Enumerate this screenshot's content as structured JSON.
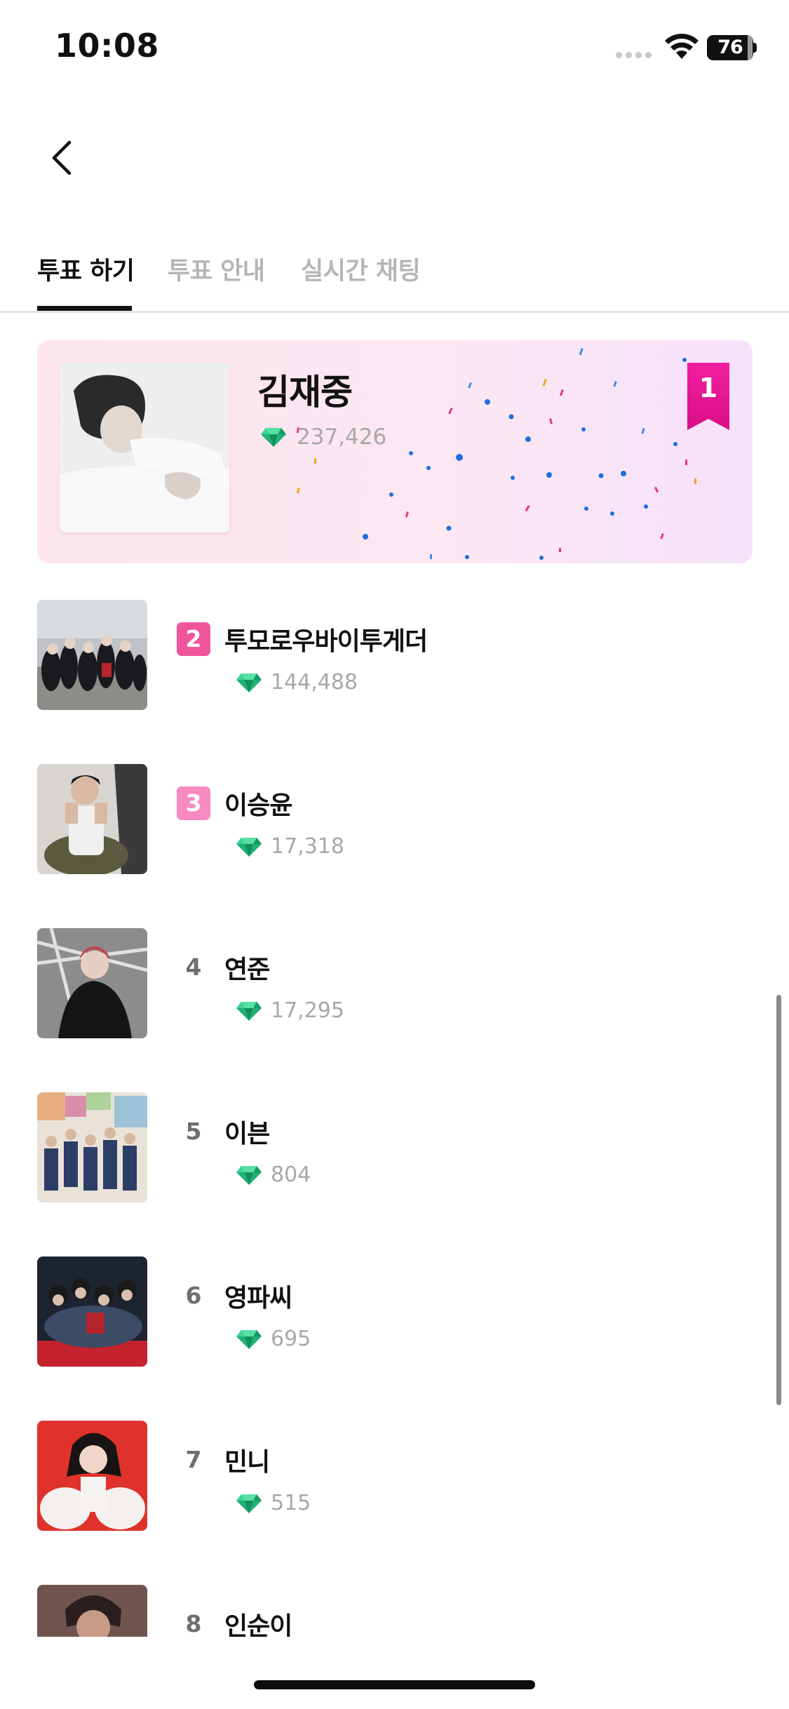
{
  "status_bar": {
    "time": "10:08",
    "battery": "76"
  },
  "nav": {
    "back_icon": "chevron-left-icon"
  },
  "tabs": [
    {
      "label": "투표 하기",
      "active": true
    },
    {
      "label": "투표 안내",
      "active": false
    },
    {
      "label": "실시간 채팅",
      "active": false
    }
  ],
  "top_card": {
    "rank": "1",
    "name": "김재중",
    "votes": "237,426"
  },
  "rankings": [
    {
      "rank": "2",
      "name": "투모로우바이투게더",
      "votes": "144,488",
      "badge_color": "#f0559c"
    },
    {
      "rank": "3",
      "name": "이승윤",
      "votes": "17,318",
      "badge_color": "#f78ac0"
    },
    {
      "rank": "4",
      "name": "연준",
      "votes": "17,295"
    },
    {
      "rank": "5",
      "name": "이븐",
      "votes": "804"
    },
    {
      "rank": "6",
      "name": "영파씨",
      "votes": "695"
    },
    {
      "rank": "7",
      "name": "민니",
      "votes": "515"
    },
    {
      "rank": "8",
      "name": "인순이",
      "votes": ""
    }
  ],
  "icons": {
    "vote": "gem-icon",
    "rank_badge": "ribbon-icon"
  },
  "colors": {
    "accent": "#e91e8c",
    "gem": "#22b07a",
    "vote_text": "#a8a8a8"
  }
}
